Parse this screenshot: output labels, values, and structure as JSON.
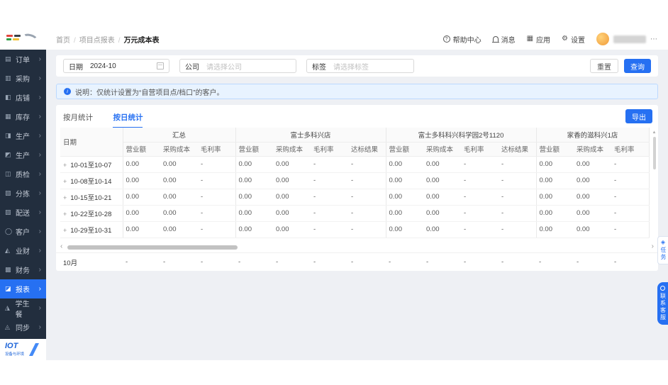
{
  "colors": {
    "accent": "#2670f2",
    "sidebar_bg": "#222e3e",
    "banner_bg": "#e8f3ff",
    "main_bg": "#eef0f4"
  },
  "header": {
    "breadcrumb": [
      "首页",
      "项目点报表",
      "万元成本表"
    ],
    "actions": [
      {
        "id": "help",
        "icon": "help-circle-icon",
        "label": "帮助中心"
      },
      {
        "id": "message",
        "icon": "bell-icon",
        "label": "消息"
      },
      {
        "id": "apps",
        "icon": "apps-grid-icon",
        "label": "应用"
      },
      {
        "id": "settings",
        "icon": "gear-icon",
        "label": "设置"
      }
    ]
  },
  "sidebar": {
    "items": [
      {
        "id": "orders",
        "icon": "orders-icon",
        "glyph": "▤",
        "label": "订单"
      },
      {
        "id": "procurement",
        "icon": "procurement-icon",
        "glyph": "▥",
        "label": "采购"
      },
      {
        "id": "shop",
        "icon": "shop-icon",
        "glyph": "◧",
        "label": "店铺"
      },
      {
        "id": "inventory",
        "icon": "inventory-icon",
        "glyph": "▦",
        "label": "库存"
      },
      {
        "id": "production-1",
        "icon": "production-icon",
        "glyph": "◨",
        "label": "生产"
      },
      {
        "id": "production-2",
        "icon": "production-icon",
        "glyph": "◩",
        "label": "生产"
      },
      {
        "id": "quality-check",
        "icon": "quality-icon",
        "glyph": "◫",
        "label": "质检"
      },
      {
        "id": "sorting",
        "icon": "sorting-icon",
        "glyph": "▧",
        "label": "分拣"
      },
      {
        "id": "delivery",
        "icon": "delivery-icon",
        "glyph": "▨",
        "label": "配送"
      },
      {
        "id": "customers",
        "icon": "customer-icon",
        "glyph": "◯",
        "label": "客户"
      },
      {
        "id": "biz-finance",
        "icon": "biz-finance-icon",
        "glyph": "◭",
        "label": "业财"
      },
      {
        "id": "finance",
        "icon": "finance-icon",
        "glyph": "▩",
        "label": "财务"
      },
      {
        "id": "reports",
        "icon": "reports-icon",
        "glyph": "◪",
        "label": "报表"
      },
      {
        "id": "student-meal",
        "icon": "student-meal-icon",
        "glyph": "◮",
        "label": "学生餐"
      },
      {
        "id": "sync",
        "icon": "sync-icon",
        "glyph": "◬",
        "label": "同步"
      }
    ],
    "active_index": 12,
    "footer_brand": "IOT",
    "footer_sub": "设备与环境"
  },
  "filters": {
    "date_label": "日期",
    "date_value": "2024-10",
    "company_label": "公司",
    "company_placeholder": "请选择公司",
    "tag_label": "标签",
    "tag_placeholder": "请选择标签",
    "reset_label": "重置",
    "query_label": "查询"
  },
  "notice": {
    "text": "说明：仅统计设置为“自营项目点/档口”的客户。"
  },
  "tabs": {
    "items": [
      "按月统计",
      "按日统计"
    ],
    "active_index": 1,
    "export_label": "导出"
  },
  "table": {
    "date_header": "日期",
    "groups": [
      {
        "name": "汇总",
        "cols": [
          "营业额",
          "采购成本",
          "毛利率"
        ]
      },
      {
        "name": "富士多科兴店",
        "cols": [
          "营业额",
          "采购成本",
          "毛利率",
          "达标结果"
        ]
      },
      {
        "name": "富士多科科兴科学园2号1120",
        "cols": [
          "营业额",
          "采购成本",
          "毛利率",
          "达标结果"
        ]
      },
      {
        "name": "家香的滋科兴1店",
        "cols": [
          "营业额",
          "采购成本",
          "毛利率"
        ]
      }
    ],
    "rows": [
      {
        "date": "10-01至10-07",
        "values": [
          "0.00",
          "0.00",
          "-",
          "0.00",
          "0.00",
          "-",
          "-",
          "0.00",
          "0.00",
          "-",
          "-",
          "0.00",
          "0.00",
          "-"
        ]
      },
      {
        "date": "10-08至10-14",
        "values": [
          "0.00",
          "0.00",
          "-",
          "0.00",
          "0.00",
          "-",
          "-",
          "0.00",
          "0.00",
          "-",
          "-",
          "0.00",
          "0.00",
          "-"
        ]
      },
      {
        "date": "10-15至10-21",
        "values": [
          "0.00",
          "0.00",
          "-",
          "0.00",
          "0.00",
          "-",
          "-",
          "0.00",
          "0.00",
          "-",
          "-",
          "0.00",
          "0.00",
          "-"
        ]
      },
      {
        "date": "10-22至10-28",
        "values": [
          "0.00",
          "0.00",
          "-",
          "0.00",
          "0.00",
          "-",
          "-",
          "0.00",
          "0.00",
          "-",
          "-",
          "0.00",
          "0.00",
          "-"
        ]
      },
      {
        "date": "10-29至10-31",
        "values": [
          "0.00",
          "0.00",
          "-",
          "0.00",
          "0.00",
          "-",
          "-",
          "0.00",
          "0.00",
          "-",
          "-",
          "0.00",
          "0.00",
          "-"
        ]
      }
    ],
    "footer": {
      "date": "10月",
      "values": [
        "-",
        "-",
        "-",
        "-",
        "-",
        "-",
        "-",
        "-",
        "-",
        "-",
        "-",
        "-",
        "-",
        "-"
      ]
    }
  },
  "floating": {
    "task_label": "任务",
    "support_label": "联系客服"
  }
}
